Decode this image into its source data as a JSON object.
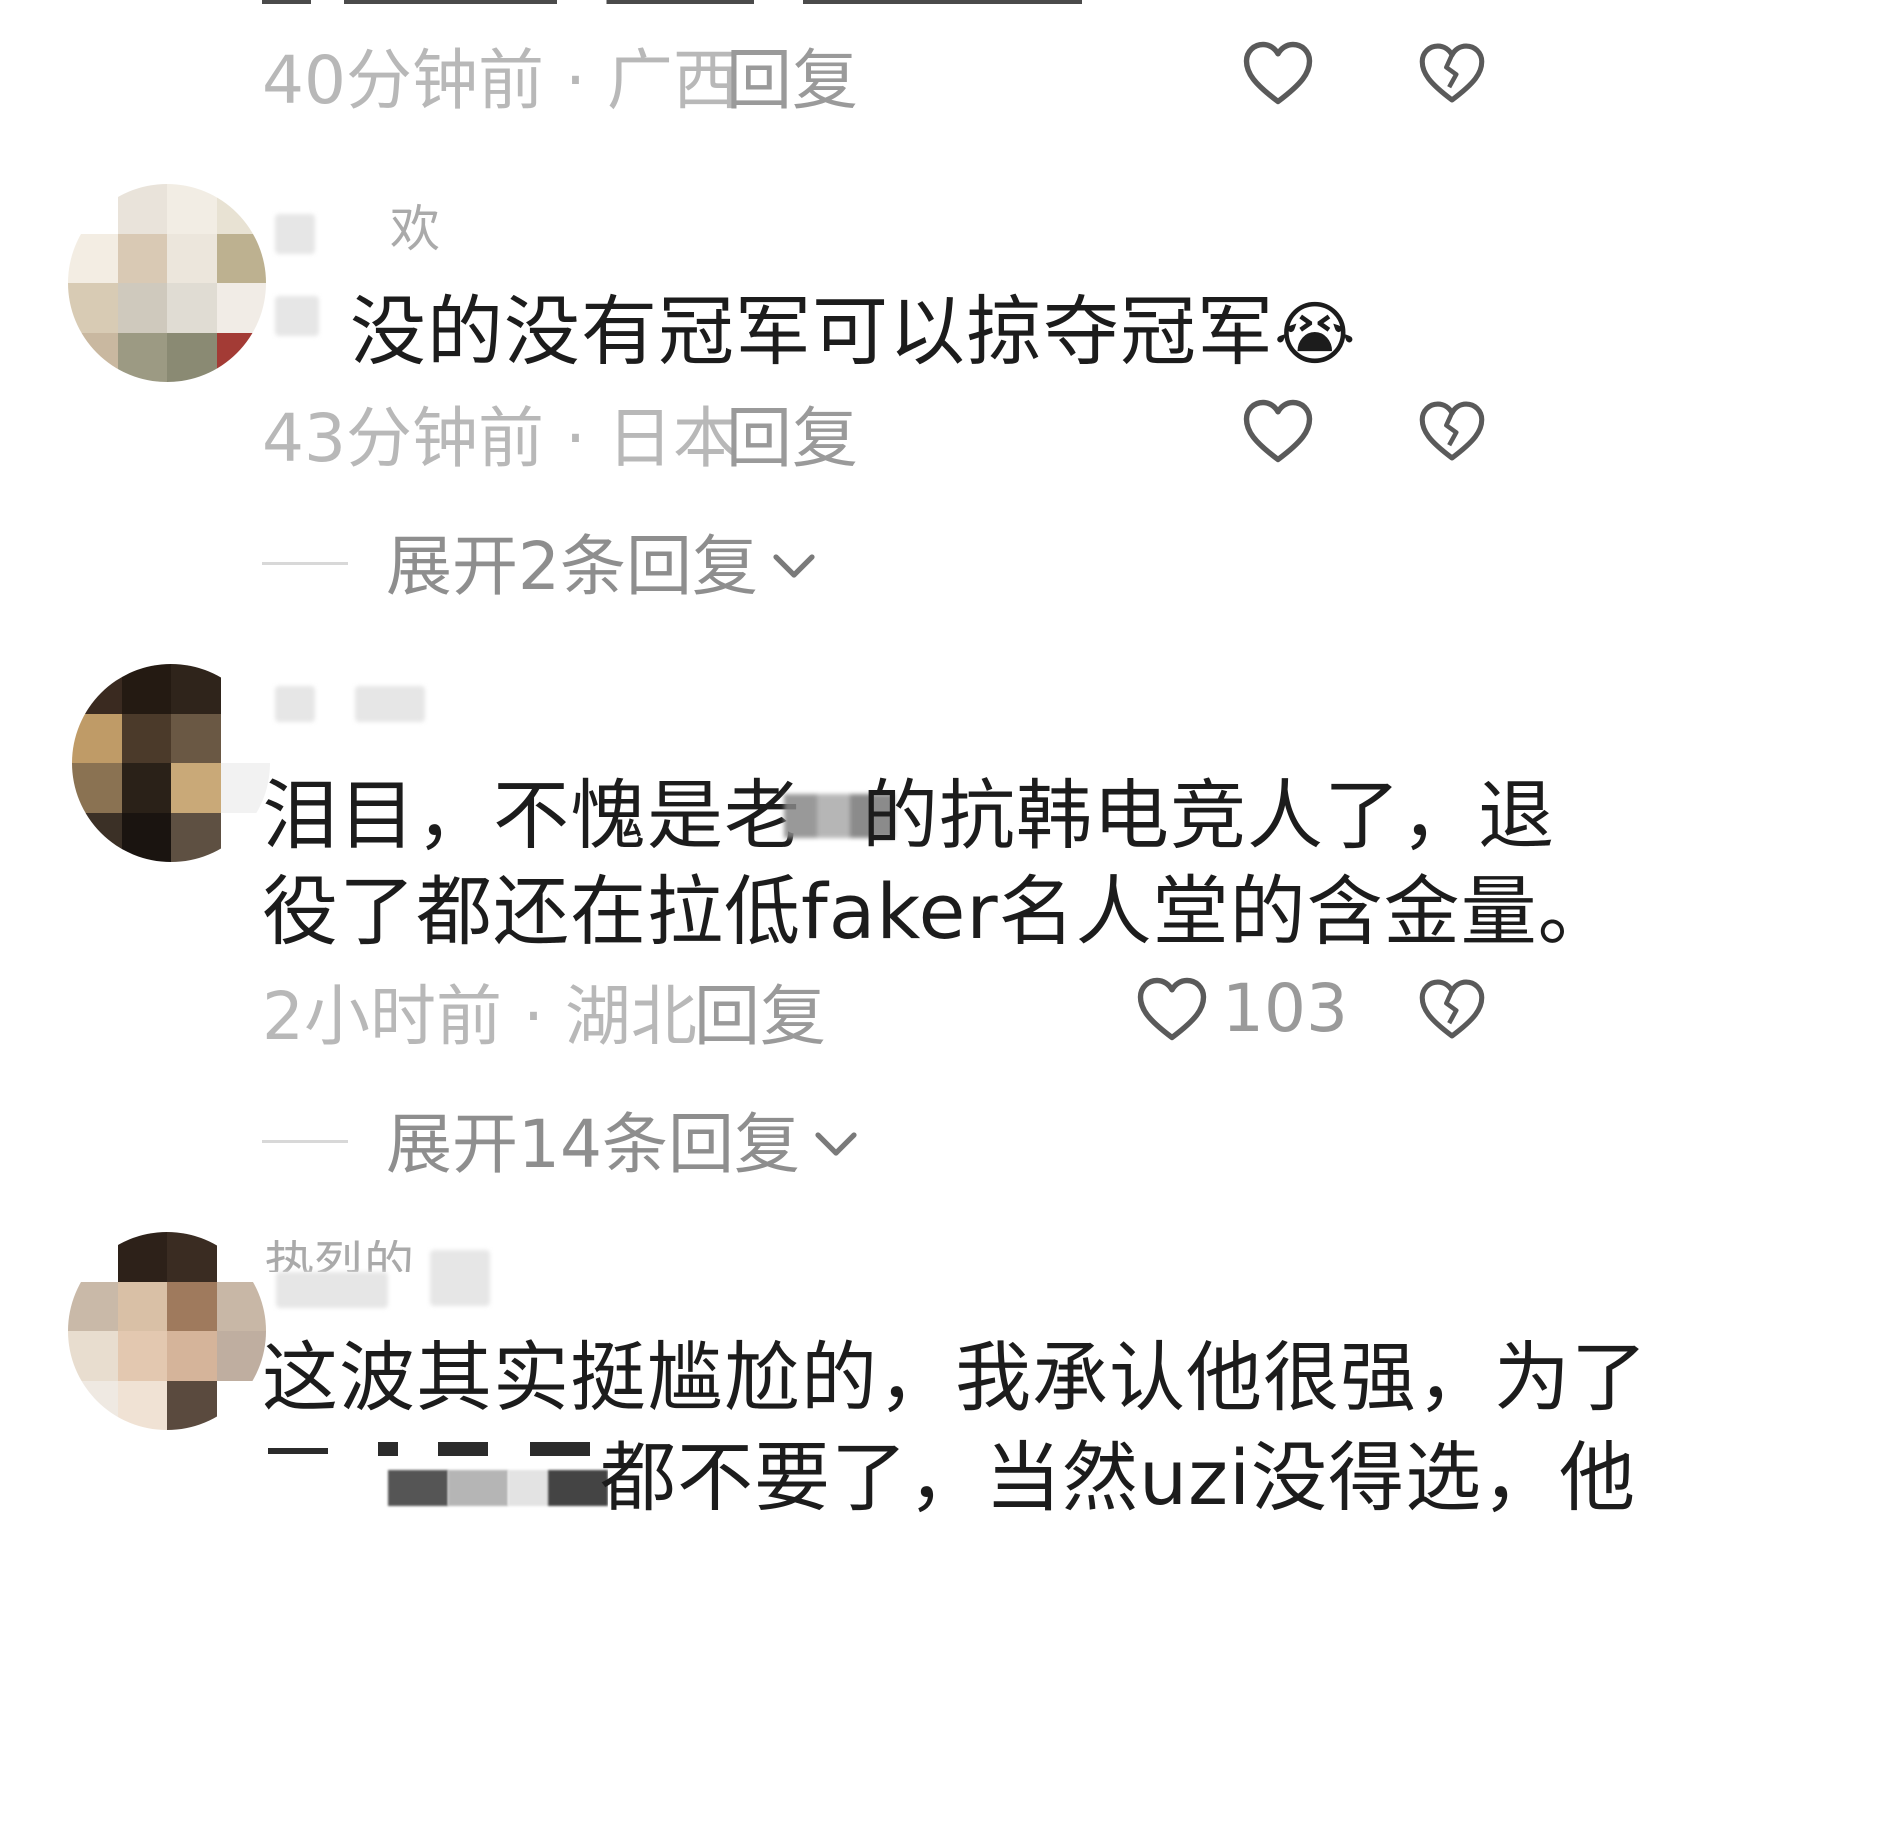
{
  "comments": [
    {
      "meta": "40分钟前 · 广西",
      "reply_label": "回复"
    },
    {
      "username_visible": "欢",
      "text": "没的没有冠军可以掠夺冠军",
      "emoji": "😭",
      "meta": "43分钟前 · 日本",
      "reply_label": "回复",
      "expand_label": "展开2条回复"
    },
    {
      "text_line1_a": "泪目，不愧是老",
      "text_line1_b": "的抗韩电竞人了，退",
      "text_line2": "役了都还在拉低faker名人堂的含金量。",
      "meta": "2小时前 · 湖北",
      "reply_label": "回复",
      "like_count": "103",
      "expand_label": "展开14条回复"
    },
    {
      "username_visible": "热烈的",
      "text_line1": "这波其实挺尴尬的，我承认他很强，为了",
      "text_line2_b": "都不要了，当然uzi没得选，他"
    }
  ],
  "icons": {
    "like": "heart-outline-icon",
    "dislike": "broken-heart-icon",
    "expand": "chevron-down-icon"
  },
  "colors": {
    "meta": "#b8b8b8",
    "text": "#1c1c1c",
    "icon": "#555555"
  }
}
